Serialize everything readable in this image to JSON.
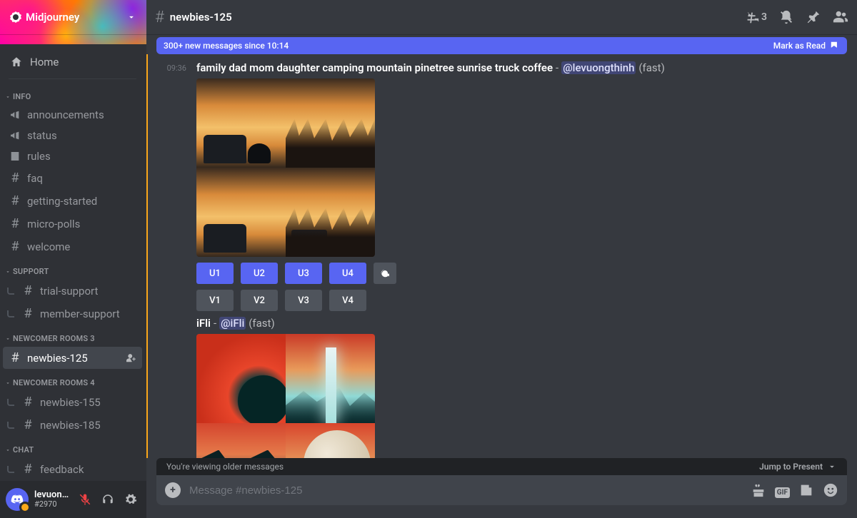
{
  "server": {
    "name": "Midjourney"
  },
  "sidebar": {
    "home": "Home",
    "categories": [
      {
        "name": "INFO",
        "items": [
          {
            "icon": "megaphone",
            "label": "announcements"
          },
          {
            "icon": "megaphone",
            "label": "status"
          },
          {
            "icon": "rules",
            "label": "rules"
          },
          {
            "icon": "hash",
            "label": "faq"
          },
          {
            "icon": "hash",
            "label": "getting-started"
          },
          {
            "icon": "hash",
            "label": "micro-polls"
          },
          {
            "icon": "hash",
            "label": "welcome"
          }
        ]
      },
      {
        "name": "SUPPORT",
        "items": [
          {
            "icon": "hash",
            "label": "trial-support",
            "thread": true
          },
          {
            "icon": "hash",
            "label": "member-support",
            "thread": true
          }
        ]
      },
      {
        "name": "NEWCOMER ROOMS 3",
        "items": [
          {
            "icon": "hash",
            "label": "newbies-125",
            "active": true,
            "invite": true
          }
        ]
      },
      {
        "name": "NEWCOMER ROOMS 4",
        "items": [
          {
            "icon": "hash",
            "label": "newbies-155",
            "thread": true
          },
          {
            "icon": "hash",
            "label": "newbies-185",
            "thread": true
          }
        ]
      },
      {
        "name": "CHAT",
        "items": [
          {
            "icon": "hash",
            "label": "feedback",
            "thread": true
          }
        ]
      }
    ]
  },
  "user": {
    "name": "levuongthi...",
    "tag": "#2970"
  },
  "header": {
    "channel": "newbies-125",
    "threads_count": "3"
  },
  "notif": {
    "text": "300+ new messages since 10:14",
    "mark": "Mark as Read"
  },
  "messages": [
    {
      "time": "09:36",
      "prompt": "family dad mom daughter camping mountain pinetree sunrise truck coffee",
      "mention": "@levuongthinh",
      "mode": "(fast)",
      "buttons_u": [
        "U1",
        "U2",
        "U3",
        "U4"
      ],
      "buttons_v": [
        "V1",
        "V2",
        "V3",
        "V4"
      ],
      "style": "camp"
    },
    {
      "prompt": "iFli",
      "mention": "@iFli",
      "mode": "(fast)",
      "style": "ifli"
    }
  ],
  "older": {
    "text": "You're viewing older messages",
    "jump": "Jump to Present"
  },
  "composer": {
    "placeholder": "Message #newbies-125"
  }
}
